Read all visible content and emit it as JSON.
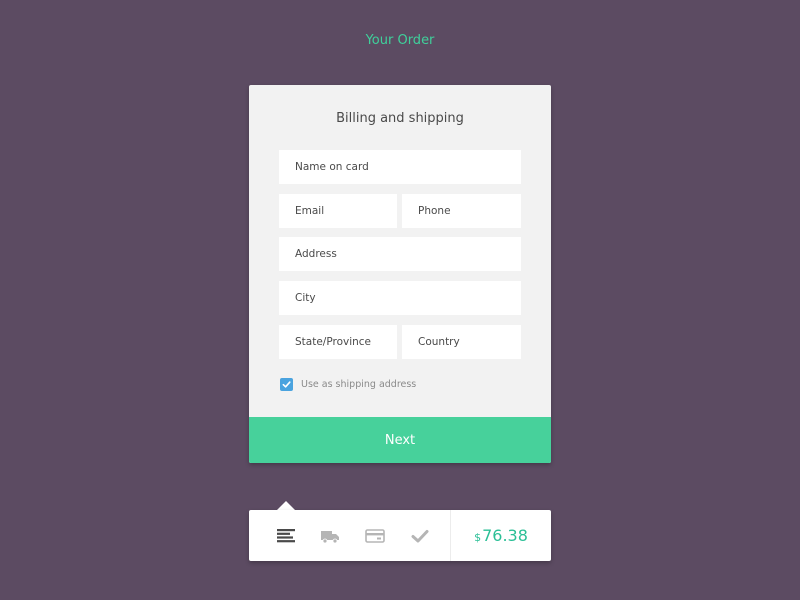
{
  "header": {
    "title": "Your Order"
  },
  "form": {
    "title": "Billing and shipping",
    "fields": {
      "name_on_card": {
        "placeholder": "Name on card",
        "value": ""
      },
      "email": {
        "placeholder": "Email",
        "value": ""
      },
      "phone": {
        "placeholder": "Phone",
        "value": ""
      },
      "address": {
        "placeholder": "Address",
        "value": ""
      },
      "city": {
        "placeholder": "City",
        "value": ""
      },
      "state": {
        "placeholder": "State/Province",
        "value": ""
      },
      "country": {
        "placeholder": "Country",
        "value": ""
      }
    },
    "shipping_checkbox": {
      "label": "Use as shipping address",
      "checked": true
    },
    "next_label": "Next"
  },
  "steps": {
    "items": [
      {
        "icon": "list-icon",
        "active": true
      },
      {
        "icon": "truck-icon",
        "active": false
      },
      {
        "icon": "credit-card-icon",
        "active": false
      },
      {
        "icon": "checkmark-icon",
        "active": false
      }
    ],
    "total": {
      "currency": "$",
      "amount": "76.38"
    }
  },
  "colors": {
    "background": "#5c4b62",
    "accent": "#47d19b",
    "price": "#2bbf96",
    "checkbox": "#4aa3df",
    "active_icon": "#4a4a4a",
    "inactive_icon": "#b5b5b5"
  }
}
